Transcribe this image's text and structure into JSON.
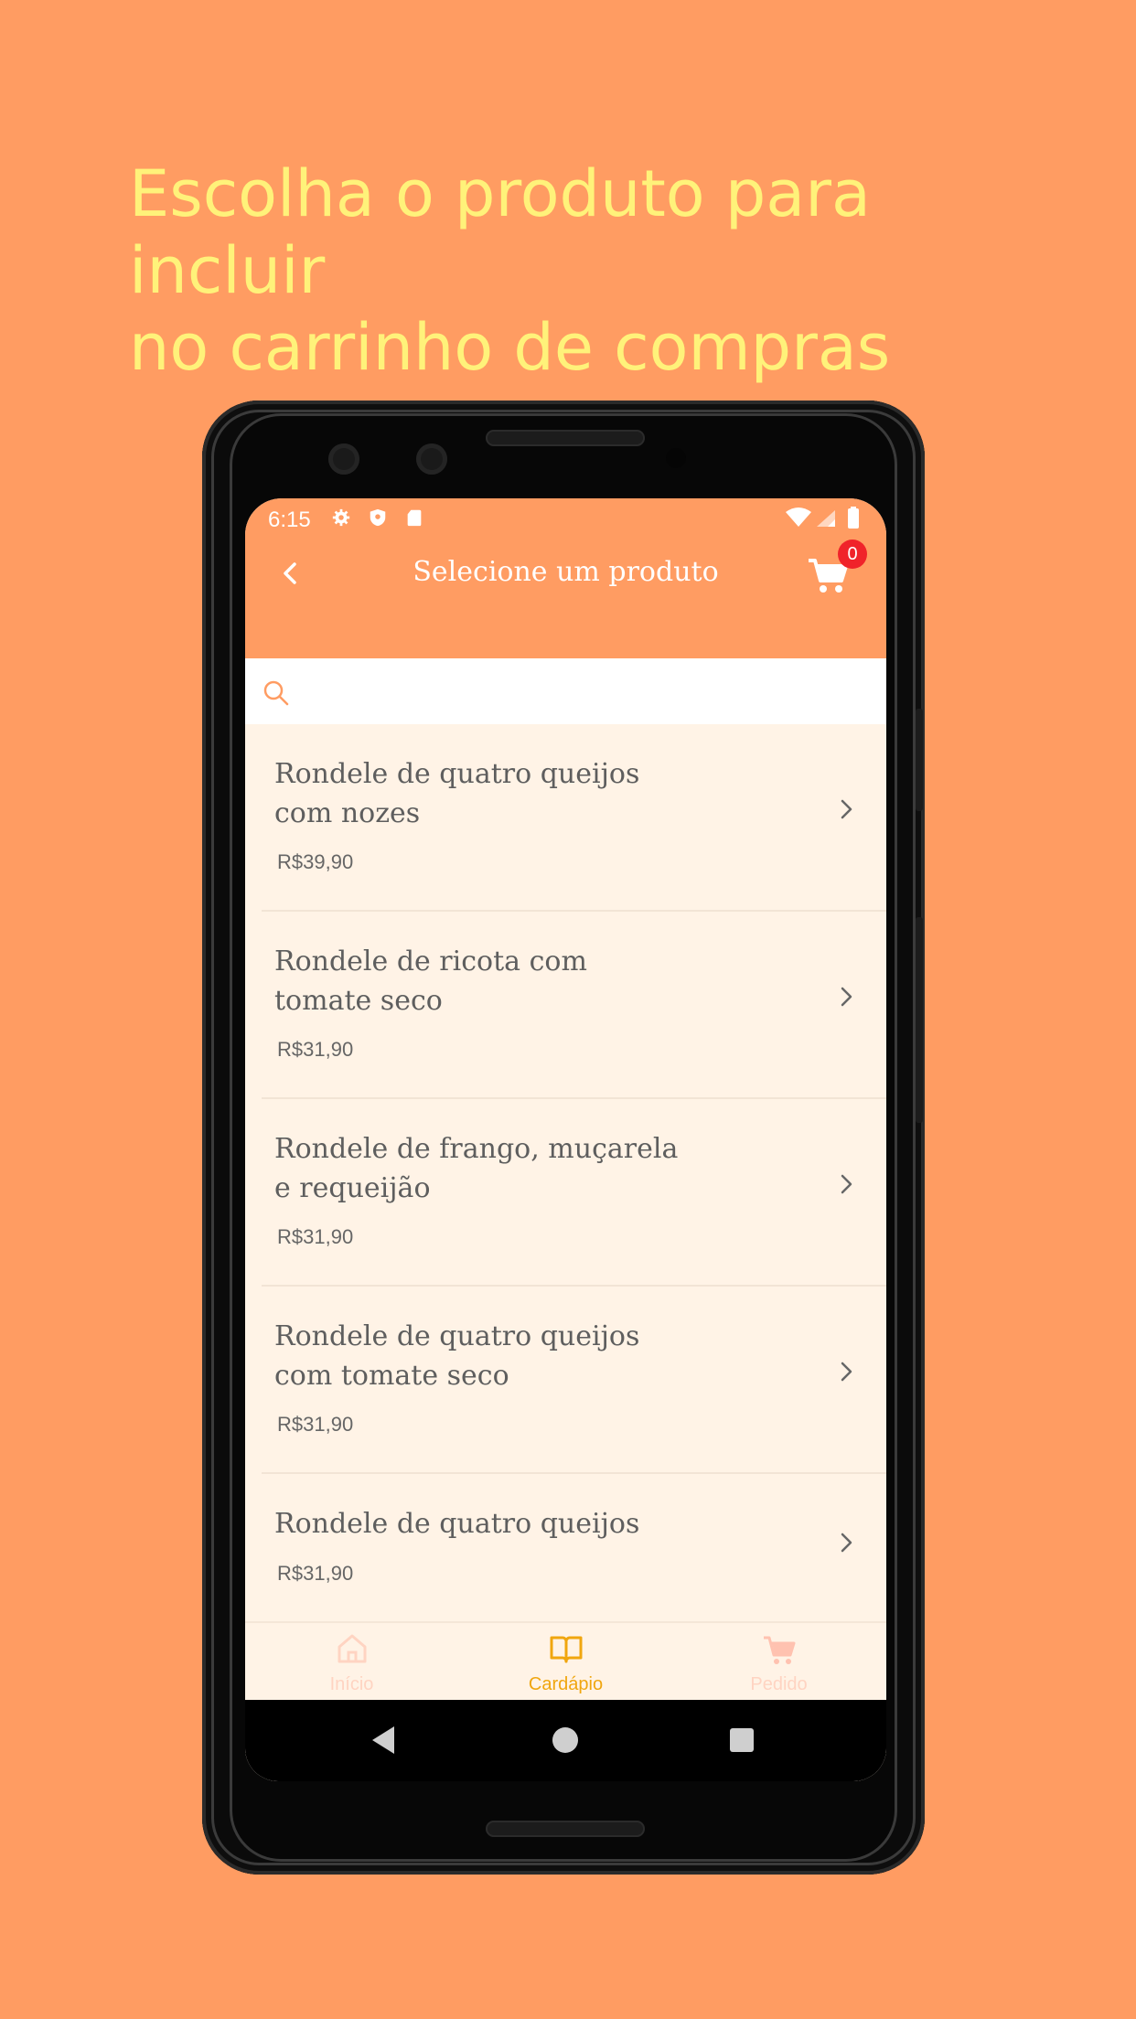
{
  "promo": {
    "headline_line1": "Escolha o produto para incluir",
    "headline_line2": "no carrinho de compras"
  },
  "status_bar": {
    "time": "6:15"
  },
  "app_bar": {
    "title": "Selecione um produto",
    "cart_count": "0"
  },
  "search": {
    "value": "",
    "placeholder": ""
  },
  "products": [
    {
      "name_line1": "Rondele de quatro queijos",
      "name_line2": "com nozes",
      "price": "R$39,90"
    },
    {
      "name_line1": "Rondele de ricota com",
      "name_line2": "tomate seco",
      "price": "R$31,90"
    },
    {
      "name_line1": "Rondele de frango, muçarela",
      "name_line2": "e requeijão",
      "price": "R$31,90"
    },
    {
      "name_line1": "Rondele de quatro queijos",
      "name_line2": "com tomate seco",
      "price": "R$31,90"
    },
    {
      "name_line1": "Rondele de quatro queijos",
      "name_line2": "",
      "price": "R$31,90"
    }
  ],
  "bottom_nav": {
    "tabs": [
      {
        "label": "Início",
        "icon": "home-icon",
        "active": false
      },
      {
        "label": "Cardápio",
        "icon": "book-icon",
        "active": true
      },
      {
        "label": "Pedido",
        "icon": "cart-icon",
        "active": false
      }
    ]
  },
  "colors": {
    "background": "#FF9C62",
    "headline": "#FFF27A",
    "list_background": "#FFF3E6",
    "badge": "#F0232A",
    "active_tab": "#F0A60F"
  }
}
